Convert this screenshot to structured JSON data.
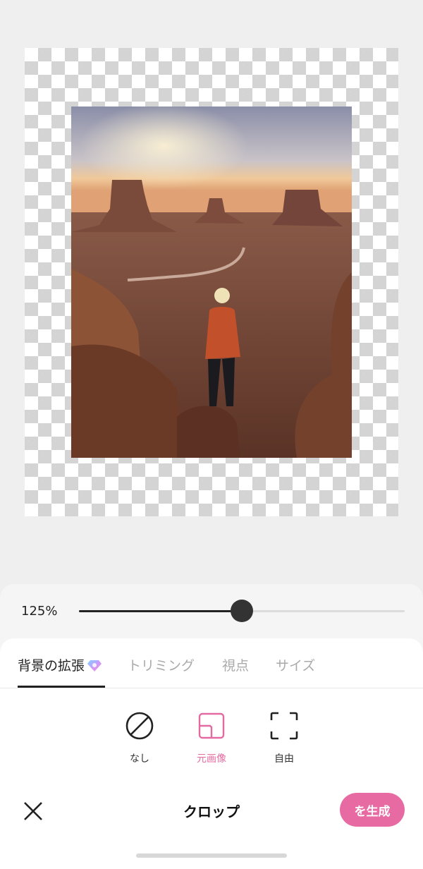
{
  "zoom": {
    "label": "125%",
    "fraction": 0.5
  },
  "tabs": [
    {
      "label": "背景の拡張",
      "active": true,
      "badge": "gem-icon"
    },
    {
      "label": "トリミング",
      "active": false
    },
    {
      "label": "視点",
      "active": false
    },
    {
      "label": "サイズ",
      "active": false
    }
  ],
  "crop_options": [
    {
      "label": "なし",
      "icon": "none-icon",
      "selected": false
    },
    {
      "label": "元画像",
      "icon": "original-ratio-icon",
      "selected": true
    },
    {
      "label": "自由",
      "icon": "freeform-icon",
      "selected": false
    }
  ],
  "footer": {
    "title": "クロップ",
    "generate_label": "を生成",
    "close_icon": "close-icon"
  },
  "colors": {
    "accent": "#e86aa3",
    "accent_text": "#e46ba2"
  }
}
